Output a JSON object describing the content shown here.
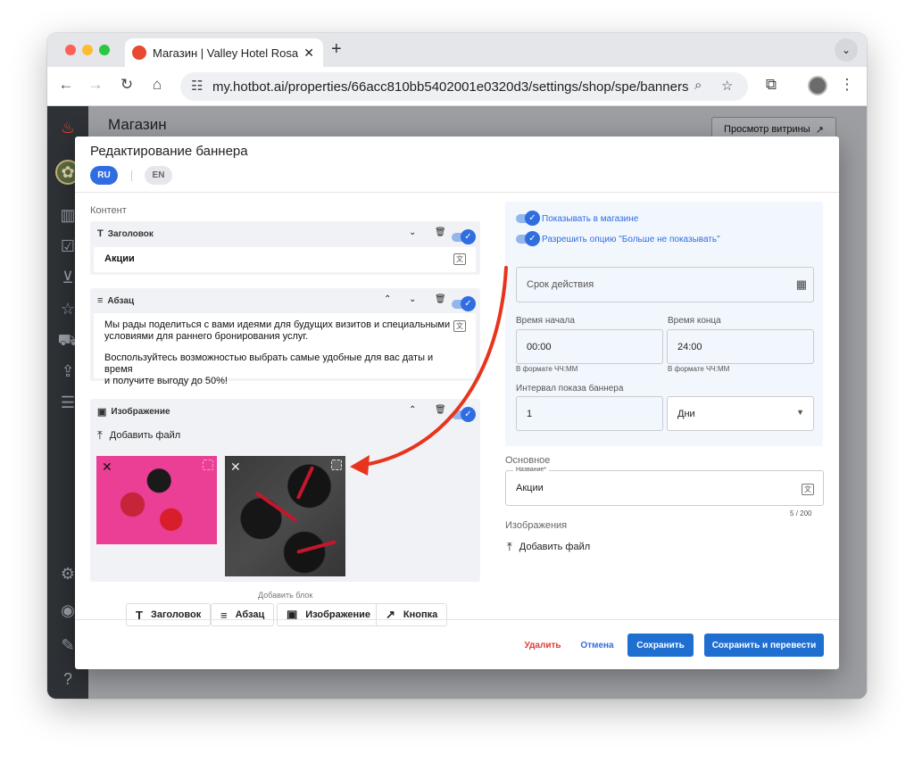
{
  "browser": {
    "tab_title": "Магазин | Valley Hotel Rosa K",
    "new_tab_icon": "+",
    "url": "my.hotbot.ai/properties/66acc810bb5402001e0320d3/settings/shop/spe/banners"
  },
  "background": {
    "page_title": "Магазин",
    "preview_button": "Просмотр витрины"
  },
  "modal": {
    "title": "Редактирование баннера",
    "languages": [
      "RU",
      "EN"
    ],
    "content_label": "Контент",
    "blocks": {
      "heading": {
        "label": "Заголовок",
        "value": "Акции"
      },
      "paragraph": {
        "label": "Абзац",
        "lines": [
          "Мы рады поделиться с вами идеями для будущих визитов и специальными",
          "условиями для раннего бронирования услуг.",
          "Воспользуйтесь возможностью выбрать самые удобные для вас даты и время",
          "и получите выгоду до 50%!"
        ]
      },
      "image": {
        "label": "Изображение",
        "add_file": "Добавить файл"
      }
    },
    "add_block_label": "Добавить блок",
    "add_block_buttons": [
      "Заголовок",
      "Абзац",
      "Изображение",
      "Кнопка"
    ],
    "settings": {
      "show_in_store": "Показывать в магазине",
      "allow_dont_show": "Разрешить опцию \"Больше не показывать\"",
      "validity_placeholder": "Срок действия",
      "start_label": "Время начала",
      "end_label": "Время конца",
      "start_value": "00:00",
      "end_value": "24:00",
      "time_format_hint": "В формате ЧЧ:ММ",
      "interval_label": "Интервал показа баннера",
      "interval_value": "1",
      "interval_unit": "Дни"
    },
    "main_section": {
      "label": "Основное",
      "name_label": "Название*",
      "name_value": "Акции",
      "counter": "5 / 200"
    },
    "images_section": {
      "label": "Изображения",
      "add_file": "Добавить файл"
    },
    "footer": {
      "delete": "Удалить",
      "cancel": "Отмена",
      "save": "Сохранить",
      "save_translate": "Сохранить и перевести"
    }
  },
  "colors": {
    "accent": "#2f6de0",
    "primary_button": "#1f6fd1",
    "danger": "#e23b33",
    "arrow": "#e8341c"
  }
}
